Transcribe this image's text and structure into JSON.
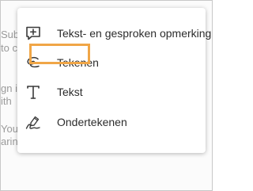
{
  "background": {
    "fragments": [
      "Sub",
      "to c",
      "gn i",
      "ith",
      "You",
      "arin"
    ]
  },
  "menu": {
    "items": [
      {
        "label": "Tekst- en gesproken opmerking",
        "icon": "comment-plus-icon"
      },
      {
        "label": "Tekenen",
        "icon": "draw-loop-icon"
      },
      {
        "label": "Tekst",
        "icon": "text-t-icon"
      },
      {
        "label": "Ondertekenen",
        "icon": "sign-pen-icon"
      }
    ]
  },
  "colors": {
    "highlight": "#f0a647",
    "text": "#2c2c2c",
    "icon": "#3a3a3a",
    "background_text": "#9a9a9a"
  }
}
